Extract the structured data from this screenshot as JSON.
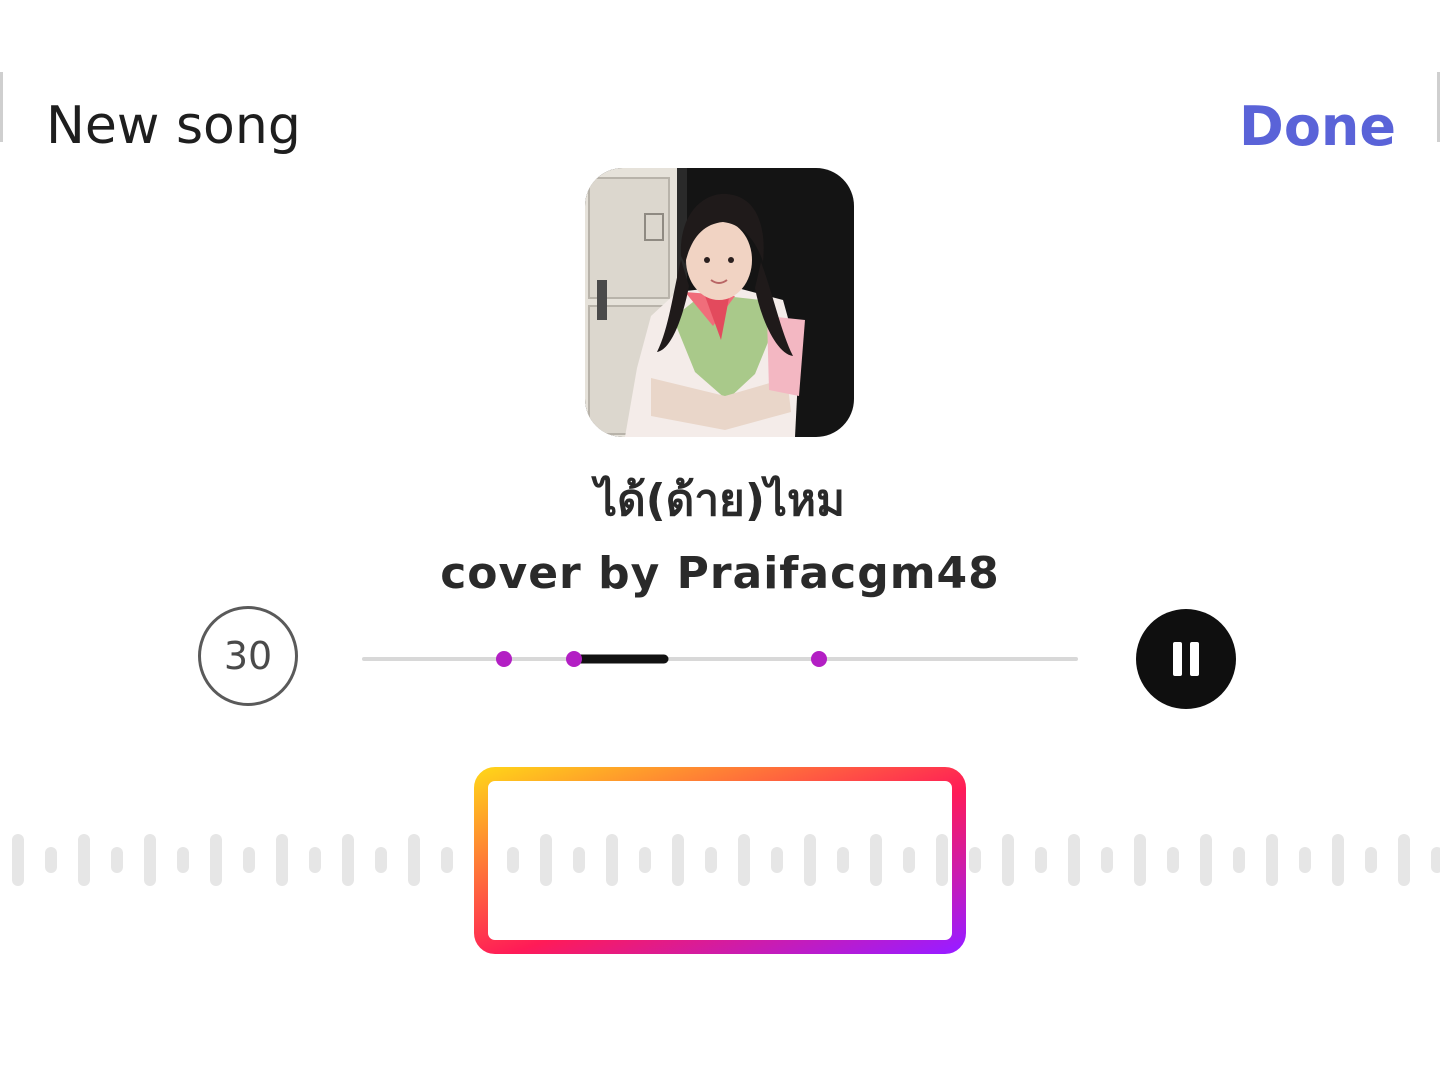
{
  "header": {
    "title": "New song",
    "done_label": "Done"
  },
  "song": {
    "title": "ได้(ด้าย)ไหม",
    "artist": "cover by Praifacgm48"
  },
  "controls": {
    "duration_label": "30",
    "pause_icon": "pause-icon"
  },
  "colors": {
    "accent": "#5a63d8",
    "marker": "#b31fc4",
    "gradient_start": "#ffcf1a",
    "gradient_mid": "#ff1b57",
    "gradient_end": "#9b1cff"
  }
}
